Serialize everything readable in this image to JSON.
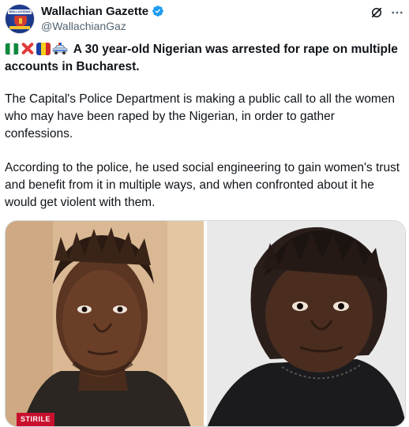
{
  "author": {
    "display_name": "Wallachian Gazette",
    "handle": "@WallachianGaz",
    "avatar_text": "WALLACHIAN GAZETTE"
  },
  "icons": {
    "verified": "verified-badge-icon",
    "grok": "grok-icon",
    "more": "more-options-icon"
  },
  "colors": {
    "verified_blue": "#1d9bf0",
    "text_primary": "#0f1419",
    "text_secondary": "#536471",
    "border": "#cfd9de"
  },
  "tweet": {
    "headline": "A 30 year-old Nigerian was arrested for rape on multiple accounts in Bucharest.",
    "paragraph_2": "The Capital's Police Department is making a public call to all the women who may have been raped by the Nigerian, in order to gather confessions.",
    "paragraph_3": "According to the police, he used social engineering to gain women's trust and benefit from it in multiple ways, and when confronted about it he would get violent with them."
  },
  "media": {
    "left_overlay_label": "STIRILE"
  }
}
